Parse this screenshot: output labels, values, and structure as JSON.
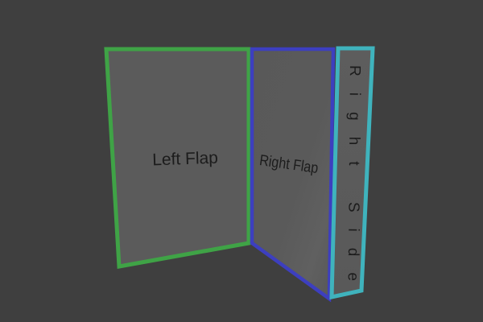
{
  "panels": {
    "left_flap": {
      "label": "Left Flap",
      "border_color": "#3fa346"
    },
    "right_flap": {
      "label": "Right Flap",
      "border_color": "#3d3fbf"
    },
    "right_side": {
      "label": "Right Side",
      "border_color": "#3fb3bd"
    }
  },
  "colors": {
    "background": "#3f3f3f",
    "panel_fill": "#5b5b5b",
    "label_text": "#1c1c1c"
  }
}
